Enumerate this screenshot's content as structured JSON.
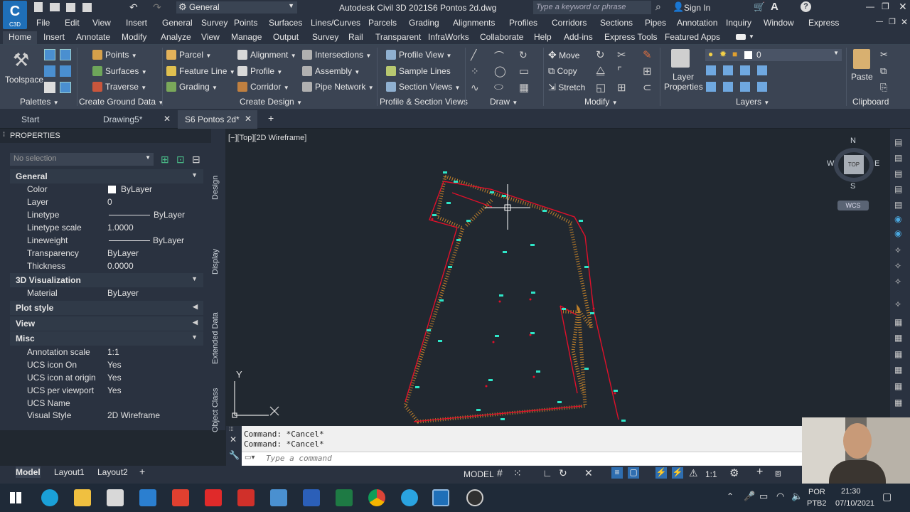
{
  "titlebar": {
    "app_title": "Autodesk Civil 3D 2021",
    "file_name": "S6 Pontos 2d.dwg",
    "workspace": "General",
    "search_placeholder": "Type a keyword or phrase",
    "sign_in": "Sign In",
    "app_badge": "C3D"
  },
  "menubar": {
    "items": [
      "File",
      "Edit",
      "View",
      "Insert",
      "General",
      "Survey",
      "Points",
      "Surfaces",
      "Lines/Curves",
      "Parcels",
      "Grading",
      "Alignments",
      "Profiles",
      "Corridors",
      "Sections",
      "Pipes",
      "Annotation",
      "Inquiry",
      "Window",
      "Express"
    ]
  },
  "ribbon_tabs": {
    "items": [
      "Home",
      "Insert",
      "Annotate",
      "Modify",
      "Analyze",
      "View",
      "Manage",
      "Output",
      "Survey",
      "Rail",
      "Transparent",
      "InfraWorks",
      "Collaborate",
      "Help",
      "Add-ins",
      "Express Tools",
      "Featured Apps"
    ],
    "active": "Home"
  },
  "ribbon": {
    "toolspace": "Toolspace",
    "palettes": "Palettes",
    "ground": {
      "points": "Points",
      "surfaces": "Surfaces",
      "traverse": "Traverse",
      "title": "Create Ground Data"
    },
    "design": {
      "parcel": "Parcel",
      "feature_line": "Feature Line",
      "grading": "Grading",
      "alignment": "Alignment",
      "profile": "Profile",
      "corridor": "Corridor",
      "intersections": "Intersections",
      "assembly": "Assembly",
      "pipe_network": "Pipe Network",
      "title": "Create Design"
    },
    "views": {
      "profile_view": "Profile View",
      "sample_lines": "Sample Lines",
      "section_views": "Section Views",
      "title": "Profile & Section Views"
    },
    "draw": {
      "title": "Draw"
    },
    "modify": {
      "move": "Move",
      "copy": "Copy",
      "stretch": "Stretch",
      "title": "Modify"
    },
    "layers": {
      "layer_properties": "Layer Properties",
      "current_layer": "0",
      "title": "Layers"
    },
    "clipboard": {
      "paste": "Paste",
      "title": "Clipboard"
    }
  },
  "doc_tabs": {
    "items": [
      "Start",
      "Drawing5*",
      "S6 Pontos 2d*"
    ],
    "active": "S6 Pontos 2d*"
  },
  "properties": {
    "title": "PROPERTIES",
    "selection": "No selection",
    "sections": {
      "general": "General",
      "visualization": "3D Visualization",
      "plot_style": "Plot style",
      "view": "View",
      "misc": "Misc"
    },
    "general_rows": [
      {
        "key": "Color",
        "value": "ByLayer"
      },
      {
        "key": "Layer",
        "value": "0"
      },
      {
        "key": "Linetype",
        "value": "ByLayer"
      },
      {
        "key": "Linetype scale",
        "value": "1.0000"
      },
      {
        "key": "Lineweight",
        "value": "ByLayer"
      },
      {
        "key": "Transparency",
        "value": "ByLayer"
      },
      {
        "key": "Thickness",
        "value": "0.0000"
      }
    ],
    "vis_rows": [
      {
        "key": "Material",
        "value": "ByLayer"
      }
    ],
    "misc_rows": [
      {
        "key": "Annotation scale",
        "value": "1:1"
      },
      {
        "key": "UCS icon On",
        "value": "Yes"
      },
      {
        "key": "UCS icon at origin",
        "value": "Yes"
      },
      {
        "key": "UCS per viewport",
        "value": "Yes"
      },
      {
        "key": "UCS Name",
        "value": ""
      },
      {
        "key": "Visual Style",
        "value": "2D Wireframe"
      }
    ],
    "side_tabs": [
      "Design",
      "Display",
      "Extended Data",
      "Object Class"
    ]
  },
  "viewport": {
    "label": "[−][Top][2D Wireframe]",
    "compass": {
      "n": "N",
      "s": "S",
      "e": "E",
      "w": "W",
      "top": "TOP"
    },
    "wcs": "WCS",
    "ucs_y": "Y"
  },
  "command": {
    "history": [
      "Command: *Cancel*",
      "Command: *Cancel*"
    ],
    "placeholder": "Type a command"
  },
  "status": {
    "tabs": [
      "Model",
      "Layout1",
      "Layout2"
    ],
    "active": "Model",
    "model_label": "MODEL",
    "scale": "1:1"
  },
  "taskbar": {
    "language": "POR",
    "layout": "PTB2",
    "time": "21:30",
    "date": "07/10/2021"
  },
  "colors": {
    "accent": "#0696d7",
    "boundary": "#e0102a",
    "hatch": "#d18a2a",
    "points": "#2ee6c8",
    "bg": "#212830"
  }
}
